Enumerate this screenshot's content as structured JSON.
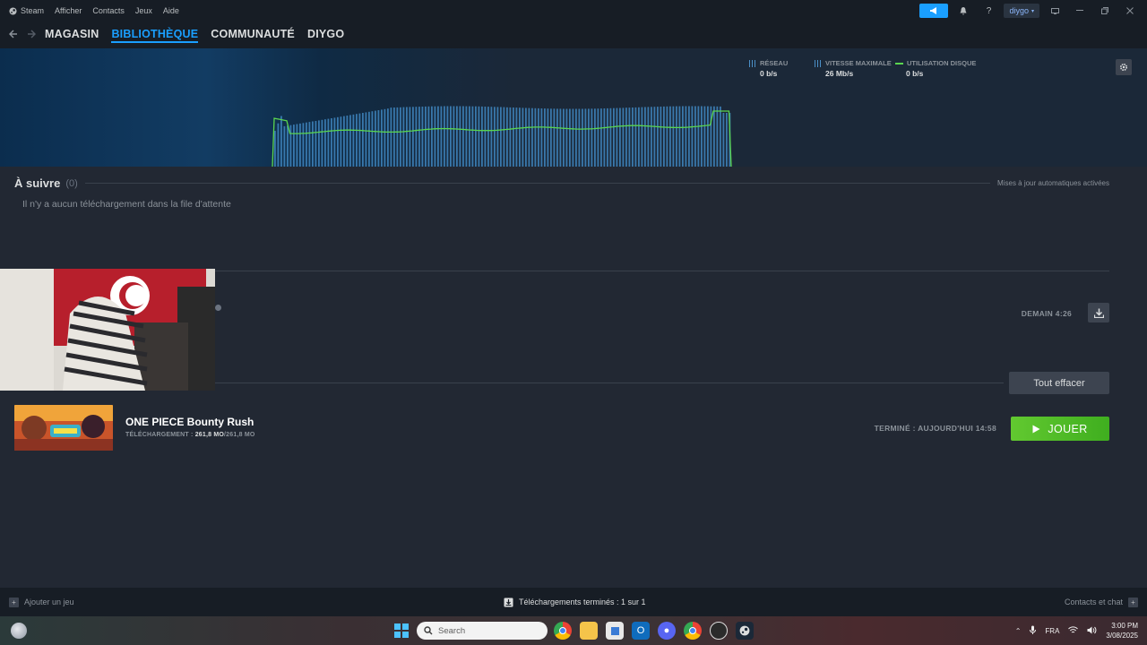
{
  "titlebar": {
    "menu": [
      "Steam",
      "Afficher",
      "Contacts",
      "Jeux",
      "Aide"
    ],
    "help": "?",
    "username": "diygo"
  },
  "nav": {
    "links": [
      "MAGASIN",
      "BIBLIOTHÈQUE",
      "COMMUNAUTÉ",
      "DIYGO"
    ],
    "active_index": 1
  },
  "graph": {
    "legend": [
      {
        "label": "RÉSEAU",
        "value": "0 b/s"
      },
      {
        "label": "VITESSE MAXIMALE",
        "value": "26 Mb/s"
      },
      {
        "label": "UTILISATION DISQUE",
        "value": "0 b/s"
      }
    ],
    "colors": {
      "bars": "#3f86c0",
      "line": "#5ad54f"
    }
  },
  "queue": {
    "title": "À suivre",
    "count": "(0)",
    "auto_updates": "Mises à jour automatiques activées",
    "empty_message": "Il n'y a aucun téléchargement dans la file d'attente"
  },
  "scheduled": {
    "time": "DEMAIN 4:26"
  },
  "completed": {
    "clear_label": "Tout effacer",
    "game": {
      "name": "ONE PIECE Bounty Rush",
      "download_label": "TÉLÉCHARGEMENT :",
      "downloaded": "261,8 MO",
      "total": "/261,8 MO",
      "status": "TERMINÉ : AUJOURD'HUI 14:58",
      "play_label": "JOUER"
    }
  },
  "statusbar": {
    "add_game": "Ajouter un jeu",
    "downloads": "Téléchargements terminés : 1 sur 1",
    "friends": "Contacts et chat"
  },
  "taskbar": {
    "search_placeholder": "Search",
    "language": "FRA",
    "time": "3:00 PM",
    "date": "3/08/2025"
  }
}
